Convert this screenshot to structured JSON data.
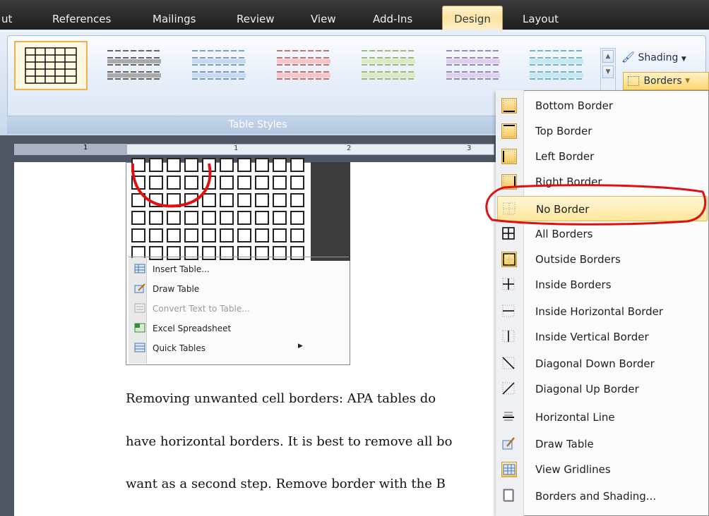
{
  "ribbon_tabs": [
    "ut",
    "References",
    "Mailings",
    "Review",
    "View",
    "Add-Ins",
    "Design",
    "Layout"
  ],
  "active_tab": "Design",
  "table_styles_label": "Table Styles",
  "shading_label": "Shading",
  "borders_label": "Borders",
  "ruler_marks": [
    "1",
    "1",
    "2",
    "3"
  ],
  "insert_table_menu": {
    "items": [
      {
        "label": "Insert Table...",
        "enabled": true,
        "icon": "table-icon"
      },
      {
        "label": "Draw Table",
        "enabled": true,
        "icon": "pencil-table-icon"
      },
      {
        "label": "Convert Text to Table...",
        "enabled": false,
        "icon": "convert-icon"
      },
      {
        "label": "Excel Spreadsheet",
        "enabled": true,
        "icon": "excel-icon"
      },
      {
        "label": "Quick Tables",
        "enabled": true,
        "icon": "quick-table-icon",
        "submenu": true
      }
    ]
  },
  "body_text": [
    "Removing unwanted cell borders: APA tables do",
    "have horizontal borders. It is best to remove all bo",
    "want as a second step. Remove border with the B"
  ],
  "borders_menu": {
    "items": [
      {
        "label": "Bottom Border",
        "icon": "bottom-border-icon"
      },
      {
        "label": "Top Border",
        "icon": "top-border-icon"
      },
      {
        "label": "Left Border",
        "icon": "left-border-icon"
      },
      {
        "label": "Right Border",
        "icon": "right-border-icon"
      },
      {
        "label": "No Border",
        "icon": "no-border-icon"
      },
      {
        "label": "All Borders",
        "icon": "all-borders-icon"
      },
      {
        "label": "Outside Borders",
        "icon": "outside-borders-icon"
      },
      {
        "label": "Inside Borders",
        "icon": "inside-borders-icon"
      },
      {
        "label": "Inside Horizontal Border",
        "icon": "inside-horizontal-border-icon"
      },
      {
        "label": "Inside Vertical Border",
        "icon": "inside-vertical-border-icon"
      },
      {
        "label": "Diagonal Down Border",
        "icon": "diagonal-down-border-icon"
      },
      {
        "label": "Diagonal Up Border",
        "icon": "diagonal-up-border-icon"
      },
      {
        "label": "Horizontal Line",
        "icon": "horizontal-line-icon"
      },
      {
        "label": "Draw Table",
        "icon": "draw-table-icon"
      },
      {
        "label": "View Gridlines",
        "icon": "view-gridlines-icon"
      },
      {
        "label": "Borders and Shading...",
        "icon": "borders-and-shading-icon"
      }
    ]
  },
  "colors": {
    "accent_highlight": "#fde59b",
    "annotation_red": "#e01010"
  }
}
